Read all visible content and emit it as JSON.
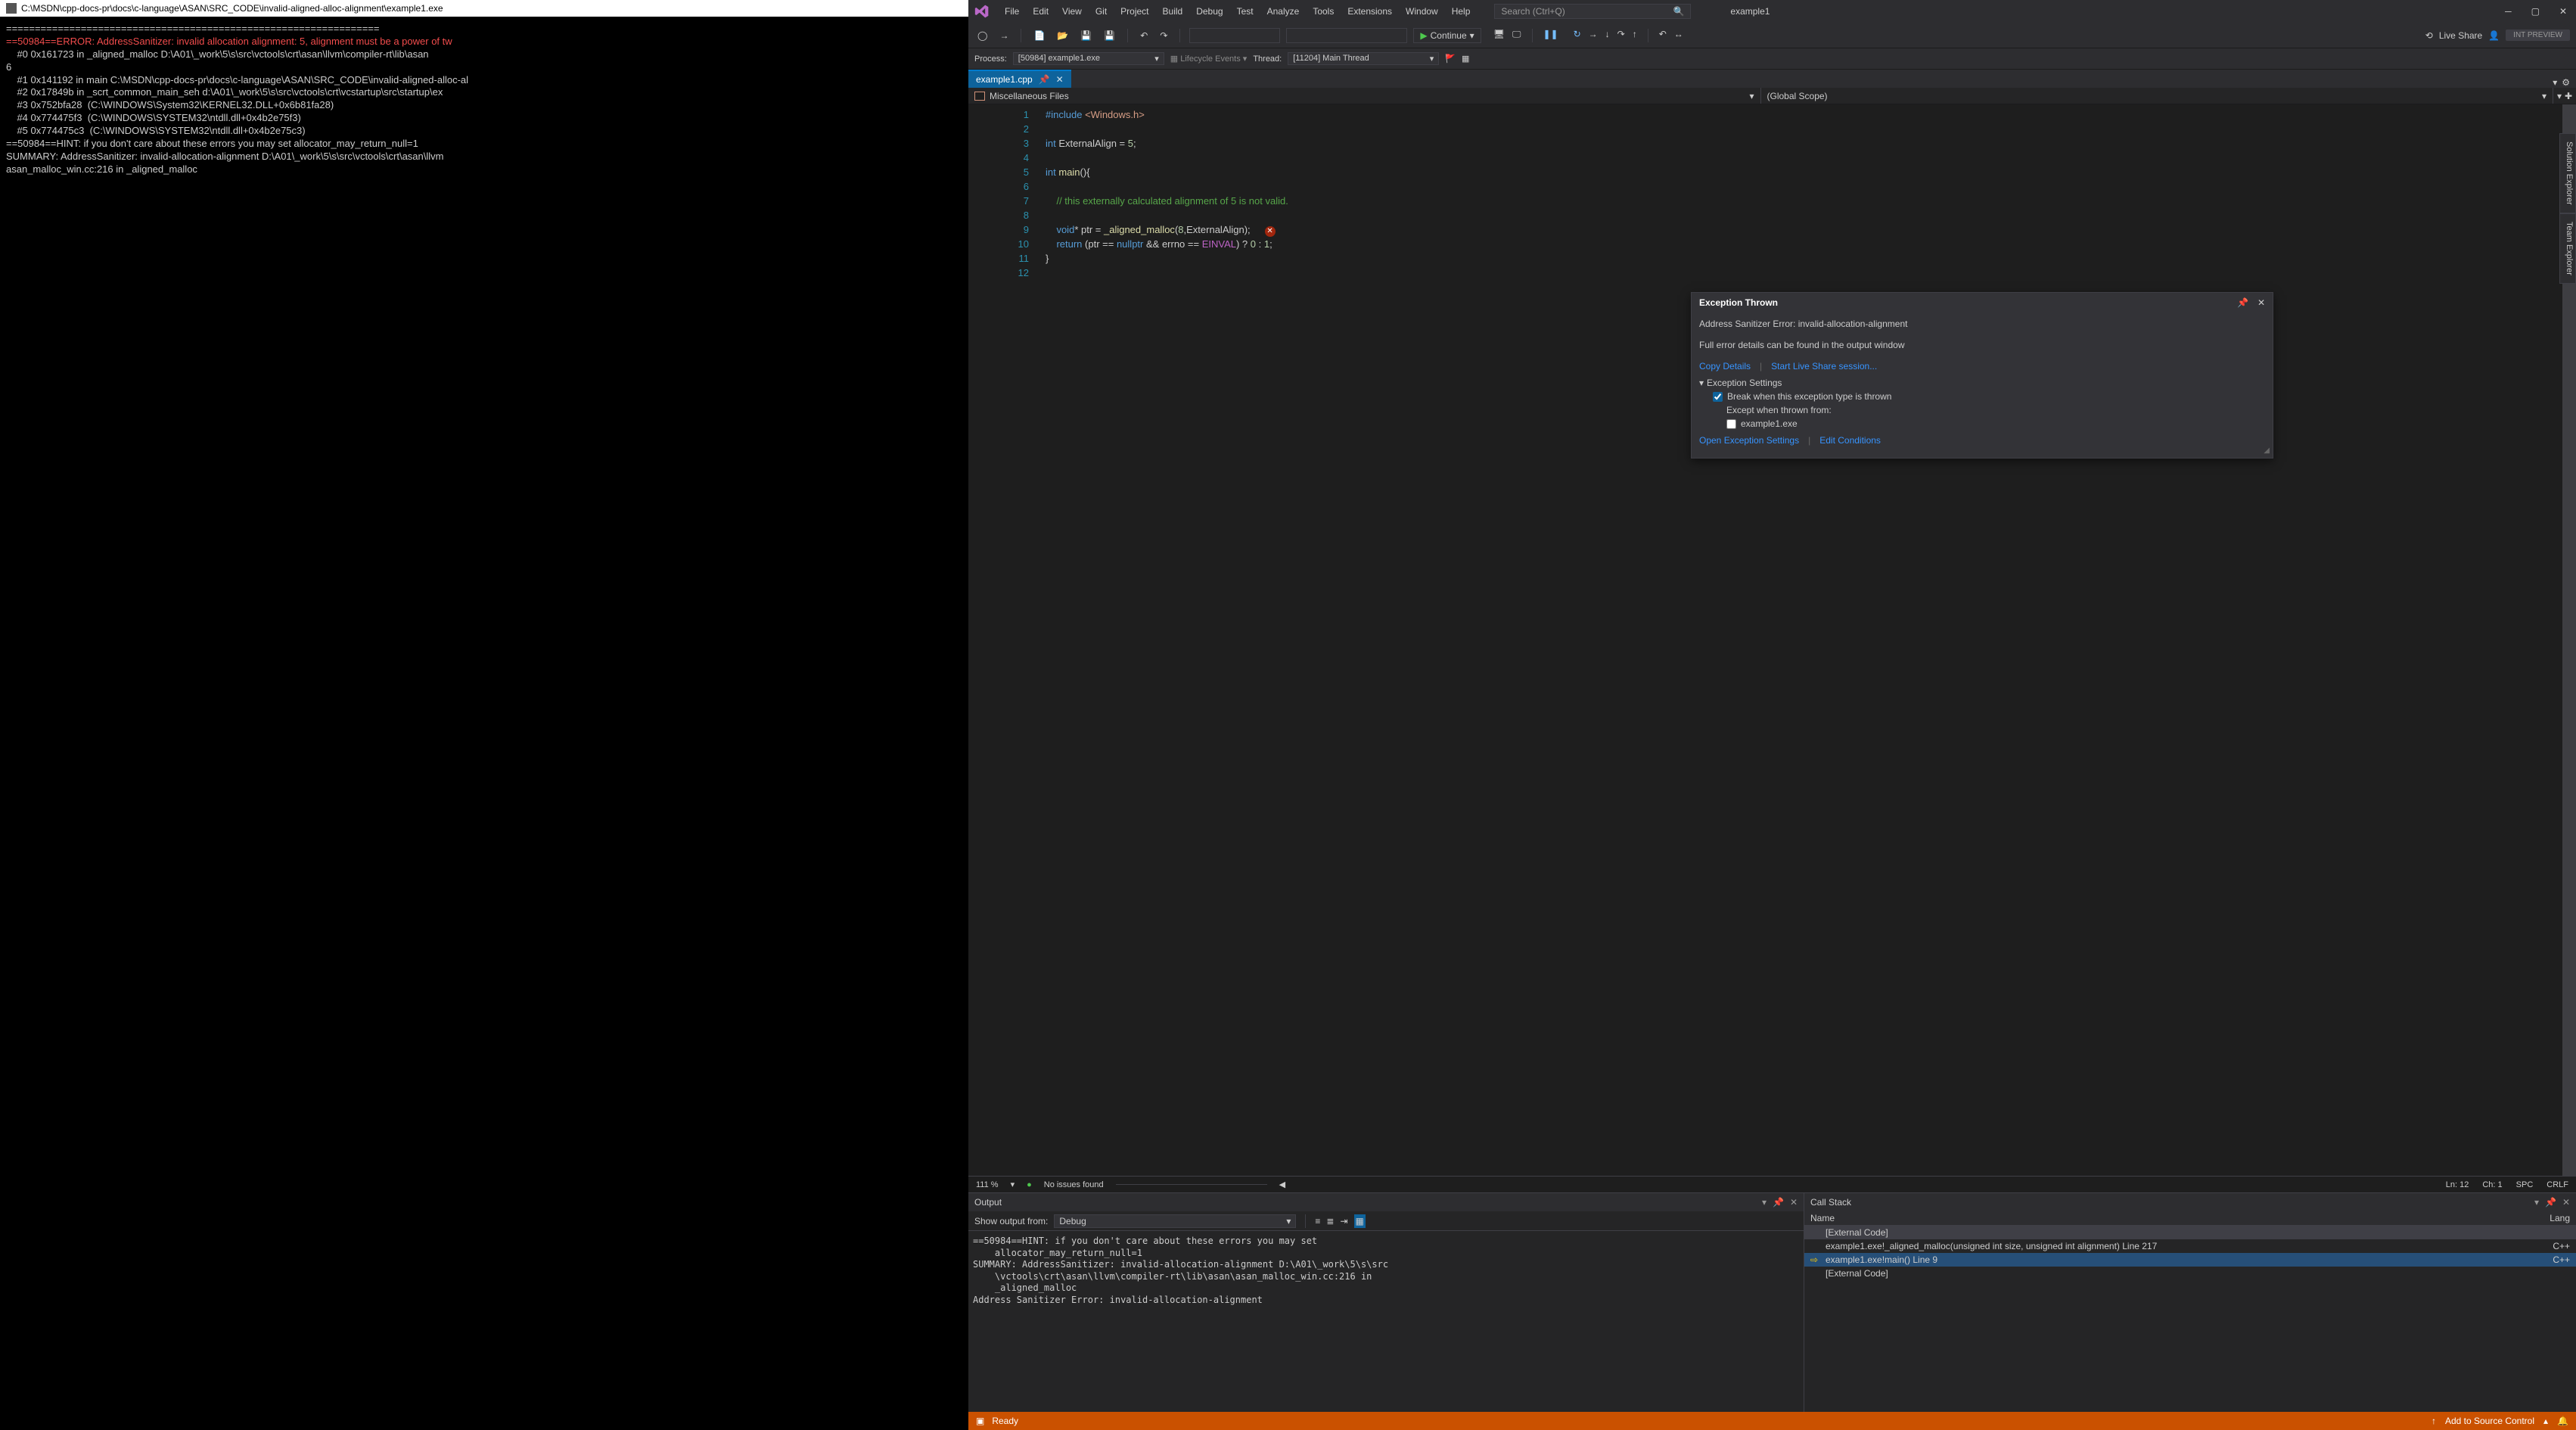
{
  "console": {
    "title": "C:\\MSDN\\cpp-docs-pr\\docs\\c-language\\ASAN\\SRC_CODE\\invalid-aligned-alloc-alignment\\example1.exe",
    "lines": [
      "=================================================================",
      "==50984==ERROR: AddressSanitizer: invalid allocation alignment: 5, alignment must be a power of tw",
      "    #0 0x161723 in _aligned_malloc D:\\A01\\_work\\5\\s\\src\\vctools\\crt\\asan\\llvm\\compiler-rt\\lib\\asan",
      "6",
      "    #1 0x141192 in main C:\\MSDN\\cpp-docs-pr\\docs\\c-language\\ASAN\\SRC_CODE\\invalid-aligned-alloc-al",
      "",
      "    #2 0x17849b in _scrt_common_main_seh d:\\A01\\_work\\5\\s\\src\\vctools\\crt\\vcstartup\\src\\startup\\ex",
      "    #3 0x752bfa28  (C:\\WINDOWS\\System32\\KERNEL32.DLL+0x6b81fa28)",
      "    #4 0x774475f3  (C:\\WINDOWS\\SYSTEM32\\ntdll.dll+0x4b2e75f3)",
      "    #5 0x774475c3  (C:\\WINDOWS\\SYSTEM32\\ntdll.dll+0x4b2e75c3)",
      "",
      "==50984==HINT: if you don't care about these errors you may set allocator_may_return_null=1",
      "SUMMARY: AddressSanitizer: invalid-allocation-alignment D:\\A01\\_work\\5\\s\\src\\vctools\\crt\\asan\\llvm",
      "asan_malloc_win.cc:216 in _aligned_malloc"
    ]
  },
  "vs": {
    "menus": [
      "File",
      "Edit",
      "View",
      "Git",
      "Project",
      "Build",
      "Debug",
      "Test",
      "Analyze",
      "Tools",
      "Extensions",
      "Window",
      "Help"
    ],
    "search_placeholder": "Search (Ctrl+Q)",
    "solution": "example1",
    "continue_label": "Continue",
    "liveshare_label": "Live Share",
    "int_preview": "INT PREVIEW",
    "process_label": "Process:",
    "process_value": "[50984] example1.exe",
    "lifecycle_label": "Lifecycle Events",
    "thread_label": "Thread:",
    "thread_value": "[11204] Main Thread",
    "tab_name": "example1.cpp",
    "nav_left": "Miscellaneous Files",
    "nav_right": "(Global Scope)",
    "code": {
      "lines": [
        {
          "n": "1",
          "html": "<span class='k-blue'>#include</span> <span class='k-str'>&lt;Windows.h&gt;</span>"
        },
        {
          "n": "2",
          "html": ""
        },
        {
          "n": "3",
          "html": "<span class='k-type'>int</span> ExternalAlign = <span class='k-num'>5</span>;"
        },
        {
          "n": "4",
          "html": ""
        },
        {
          "n": "5",
          "html": "<span class='k-type'>int</span> <span class='k-func'>main</span>(){"
        },
        {
          "n": "6",
          "html": ""
        },
        {
          "n": "7",
          "html": "    <span class='k-comment'>// this externally calculated alignment of 5 is not valid.</span>"
        },
        {
          "n": "8",
          "html": ""
        },
        {
          "n": "9",
          "html": "    <span class='k-type'>void</span>* ptr = <span class='k-func'>_aligned_malloc</span>(<span class='k-num'>8</span>,ExternalAlign);   <span class='err-circle'>✕</span>"
        },
        {
          "n": "10",
          "html": "    <span class='k-blue'>return</span> (ptr == <span class='k-blue'>nullptr</span> && errno == <span class='k-macro'>EINVAL</span>) ? <span class='k-num'>0</span> : <span class='k-num'>1</span>;"
        },
        {
          "n": "11",
          "html": "}"
        },
        {
          "n": "12",
          "html": ""
        }
      ]
    },
    "exception": {
      "title": "Exception Thrown",
      "msg": "Address Sanitizer Error: invalid-allocation-alignment",
      "detail": "Full error details can be found in the output window",
      "copy": "Copy Details",
      "liveshare": "Start Live Share session...",
      "settings_label": "Exception Settings",
      "break_label": "Break when this exception type is thrown",
      "except_label": "Except when thrown from:",
      "except_target": "example1.exe",
      "open_settings": "Open Exception Settings",
      "edit_cond": "Edit Conditions"
    },
    "statusline": {
      "zoom": "111 %",
      "issues": "No issues found",
      "ln": "Ln: 12",
      "ch": "Ch: 1",
      "spc": "SPC",
      "crlf": "CRLF"
    },
    "output": {
      "title": "Output",
      "show_from": "Show output from:",
      "source": "Debug",
      "text": "==50984==HINT: if you don't care about these errors you may set\n    allocator_may_return_null=1\nSUMMARY: AddressSanitizer: invalid-allocation-alignment D:\\A01\\_work\\5\\s\\src\n    \\vctools\\crt\\asan\\llvm\\compiler-rt\\lib\\asan\\asan_malloc_win.cc:216 in\n    _aligned_malloc\nAddress Sanitizer Error: invalid-allocation-alignment"
    },
    "callstack": {
      "title": "Call Stack",
      "col_name": "Name",
      "col_lang": "Lang",
      "rows": [
        {
          "frame": "[External Code]",
          "lang": "",
          "cls": "sel"
        },
        {
          "frame": "example1.exe!_aligned_malloc(unsigned int size, unsigned int alignment) Line 217",
          "lang": "C++",
          "cls": ""
        },
        {
          "frame": "example1.exe!main() Line 9",
          "lang": "C++",
          "cls": "cur",
          "arrow": true
        },
        {
          "frame": "[External Code]",
          "lang": "",
          "cls": ""
        }
      ]
    },
    "footer": {
      "ready": "Ready",
      "add_src": "Add to Source Control"
    },
    "sidetabs": [
      "Solution Explorer",
      "Team Explorer"
    ]
  }
}
